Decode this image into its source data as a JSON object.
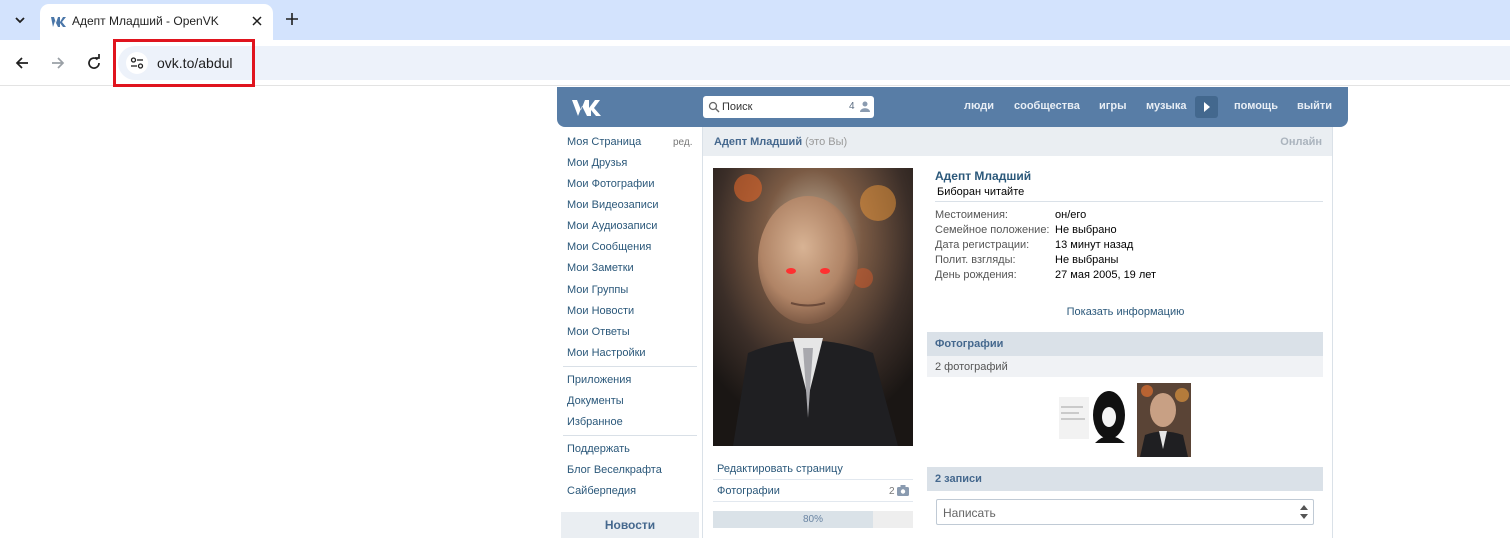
{
  "browser": {
    "tab_title": "Адепт Младший - OpenVK",
    "url": "ovk.to/abdul"
  },
  "header": {
    "search_placeholder": "Поиск",
    "search_count": "4",
    "menu": [
      "люди",
      "сообщества",
      "игры",
      "музыка",
      "помощь",
      "выйти"
    ]
  },
  "sidebar": {
    "edit_label": "ред.",
    "items": [
      "Моя Страница",
      "Мои Друзья",
      "Мои Фотографии",
      "Мои Видеозаписи",
      "Мои Аудиозаписи",
      "Мои Сообщения",
      "Мои Заметки",
      "Мои Группы",
      "Мои Новости",
      "Мои Ответы",
      "Мои Настройки"
    ],
    "items2": [
      "Приложения",
      "Документы",
      "Избранное"
    ],
    "items3": [
      "Поддержать",
      "Блог Веселкрафта",
      "Сайберпедия"
    ],
    "news_label": "Новости"
  },
  "profile": {
    "header_name": "Адепт Младший",
    "header_you": "(это Вы)",
    "online": "Онлайн",
    "name": "Адепт Младший",
    "status": "Биборан читайте",
    "fields": [
      {
        "key": "Местоимения:",
        "value": "он/его"
      },
      {
        "key": "Семейное положение:",
        "value": "Не выбрано"
      },
      {
        "key": "Дата регистрации:",
        "value": "13 минут назад"
      },
      {
        "key": "Полит. взгляды:",
        "value": "Не выбраны"
      },
      {
        "key": "День рождения:",
        "value": "27 мая 2005, 19 лет"
      }
    ],
    "show_info": "Показать информацию",
    "edit_page": "Редактировать страницу",
    "photos_link": "Фотографии",
    "photos_link_count": "2",
    "progress_label": "80%",
    "progress_value": 0.8,
    "photos_section": "Фотографии",
    "photos_count": "2 фотографий",
    "posts_section": "2 записи",
    "compose_placeholder": "Написать"
  }
}
